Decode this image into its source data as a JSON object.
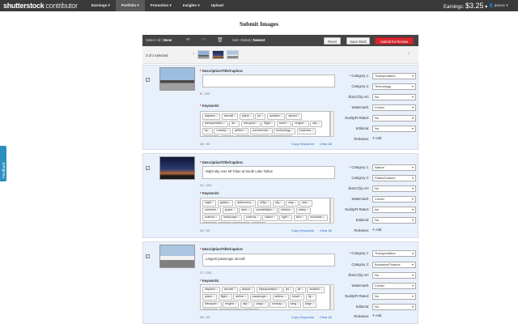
{
  "header": {
    "logo": "shutterstock",
    "logo_sub": "contributor",
    "nav": [
      "Earnings",
      "Portfolio",
      "Promotion",
      "Insights",
      "Upload"
    ],
    "earnings_label": "Earnings:",
    "earnings_value": "$3.25",
    "user": "jeanac"
  },
  "page_title": "Submit Images",
  "toolbar": {
    "select_label": "Select:",
    "select_all": "All",
    "select_sep": " | ",
    "select_none": "None",
    "sort_label": "Sort:",
    "sort_oldest": "Oldest",
    "sort_sep": " | ",
    "sort_newest": "Newest",
    "reset": "Reset",
    "save": "Save Work",
    "submit": "Submit for Review"
  },
  "strip": {
    "count": "3 of 3 selected"
  },
  "labels": {
    "description": "Description/Title/Caption:",
    "keywords": "Keywords:",
    "required_mark": "*",
    "copy_keywords": "Copy Keywords",
    "clear_all": "Clear All",
    "category1": "Category 1:",
    "category2": "Category 2:",
    "illust": "Illust./Clip Art:",
    "watermark": "Watermark:",
    "nudity": "Nudity/R-Rated:",
    "editorial": "Editorial:",
    "releases": "Releases:",
    "add": "Add",
    "add_icon": "+"
  },
  "rows": [
    {
      "checked": "✓",
      "description": "",
      "desc_count": "0",
      "desc_max": " / 200",
      "keywords": [
        "airplane",
        "aircraft",
        "plane",
        "jet",
        "aviation",
        "airport",
        "transportation",
        "air",
        "transport",
        "flight",
        "travel",
        "engine",
        "sky",
        "fly",
        "runway",
        "airliner",
        "commercial",
        "technology",
        "business",
        "landing",
        "wing",
        "airline",
        "modern",
        "aerospace"
      ],
      "kw_count": "28 / 50",
      "category1": "Transportation",
      "category2": "Technology",
      "illust": "No",
      "watermark": "Center",
      "nudity": "No",
      "editorial": "No"
    },
    {
      "checked": "✓",
      "description": "Night sky over Mt Tolan at South Lake Tahoe",
      "desc_count": "44",
      "desc_max": " / 200",
      "keywords": [
        "night",
        "galaxy",
        "astronomy",
        "milky",
        "sky",
        "way",
        "star",
        "universe",
        "space",
        "dark",
        "constellation",
        "nebula",
        "starry",
        "science",
        "landscape",
        "cosmos",
        "nature",
        "light",
        "blue",
        "mountain",
        "tahoe",
        "lake",
        "evening",
        "dusk"
      ],
      "kw_count": "38 / 50",
      "category1": "Nature",
      "category2": "Parks/Outdoor",
      "illust": "No",
      "watermark": "Center",
      "nudity": "No",
      "editorial": "No"
    },
    {
      "checked": "✓",
      "description": "Largest passenger aircraft",
      "desc_count": "27",
      "desc_max": " / 200",
      "keywords": [
        "airplane",
        "aircraft",
        "airport",
        "transportation",
        "jet",
        "air",
        "aviation",
        "plane",
        "flight",
        "airline",
        "passenger",
        "airliner",
        "travel",
        "fly",
        "transport",
        "engine",
        "sky",
        "cargo",
        "runway",
        "wing",
        "large",
        "heavy",
        "commercial",
        "tarmac"
      ],
      "kw_count": "38 / 50",
      "category1": "Transportation",
      "category2": "Business/Finance",
      "illust": "No",
      "watermark": "Center",
      "nudity": "No",
      "editorial": "No"
    }
  ],
  "feedback": "Feedback",
  "colors": {
    "accent_red": "#d6262e",
    "link_blue": "#2a6bc1",
    "row_bg": "#e8f0fb",
    "topbar": "#3a3a3a"
  }
}
